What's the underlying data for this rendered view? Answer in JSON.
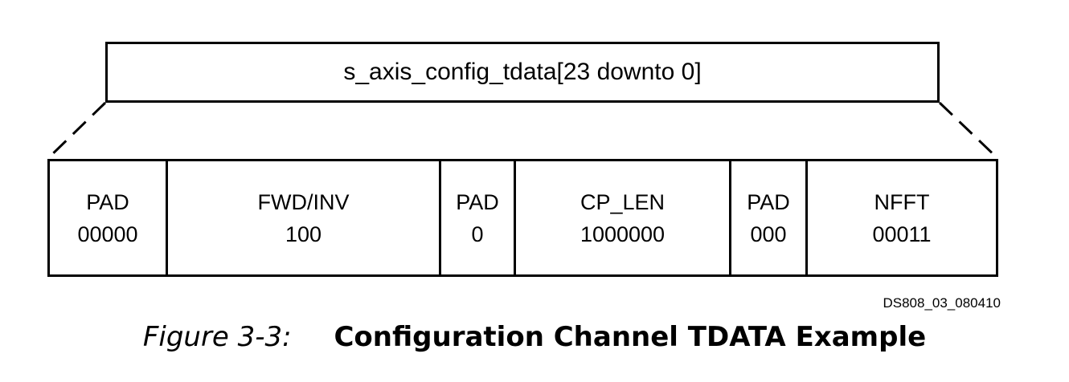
{
  "register": {
    "label": "s_axis_config_tdata[23 downto 0]"
  },
  "fields": [
    {
      "name": "PAD",
      "value": "00000"
    },
    {
      "name": "FWD/INV",
      "value": "100"
    },
    {
      "name": "PAD",
      "value": "0"
    },
    {
      "name": "CP_LEN",
      "value": "1000000"
    },
    {
      "name": "PAD",
      "value": "000"
    },
    {
      "name": "NFFT",
      "value": "00011"
    }
  ],
  "doc_id": "DS808_03_080410",
  "caption": {
    "number": "Figure 3-3:",
    "title": "Configuration Channel TDATA Example"
  }
}
